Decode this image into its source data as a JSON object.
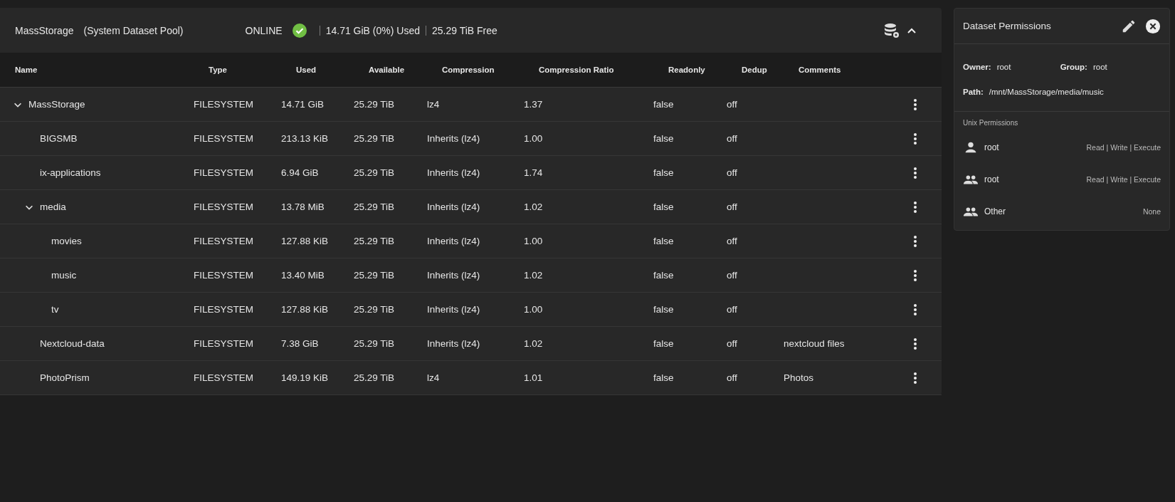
{
  "pool": {
    "name": "MassStorage",
    "subtitle": "(System Dataset Pool)",
    "status": "ONLINE",
    "healthy": true,
    "used": "14.71 GiB (0%) Used",
    "free": "25.29 TiB Free",
    "expanded": true
  },
  "table": {
    "columns": [
      "Name",
      "Type",
      "Used",
      "Available",
      "Compression",
      "Compression Ratio",
      "Readonly",
      "Dedup",
      "Comments"
    ],
    "rows": [
      {
        "name": "MassStorage",
        "type": "FILESYSTEM",
        "used": "14.71 GiB",
        "available": "25.29 TiB",
        "compression": "lz4",
        "ratio": "1.37",
        "readonly": "false",
        "dedup": "off",
        "expanded": true,
        "children": [
          {
            "name": "BIGSMB",
            "type": "FILESYSTEM",
            "used": "213.13 KiB",
            "available": "25.29 TiB",
            "compression": "Inherits (lz4)",
            "ratio": "1.00",
            "readonly": "false",
            "dedup": "off"
          },
          {
            "name": "ix-applications",
            "type": "FILESYSTEM",
            "used": "6.94 GiB",
            "available": "25.29 TiB",
            "compression": "Inherits (lz4)",
            "ratio": "1.74",
            "readonly": "false",
            "dedup": "off"
          },
          {
            "name": "media",
            "type": "FILESYSTEM",
            "used": "13.78 MiB",
            "available": "25.29 TiB",
            "compression": "Inherits (lz4)",
            "ratio": "1.02",
            "readonly": "false",
            "dedup": "off",
            "expanded": true,
            "children": [
              {
                "name": "movies",
                "type": "FILESYSTEM",
                "used": "127.88 KiB",
                "available": "25.29 TiB",
                "compression": "Inherits (lz4)",
                "ratio": "1.00",
                "readonly": "false",
                "dedup": "off"
              },
              {
                "name": "music",
                "type": "FILESYSTEM",
                "used": "13.40 MiB",
                "available": "25.29 TiB",
                "compression": "Inherits (lz4)",
                "ratio": "1.02",
                "readonly": "false",
                "dedup": "off"
              },
              {
                "name": "tv",
                "type": "FILESYSTEM",
                "used": "127.88 KiB",
                "available": "25.29 TiB",
                "compression": "Inherits (lz4)",
                "ratio": "1.00",
                "readonly": "false",
                "dedup": "off"
              }
            ]
          },
          {
            "name": "Nextcloud-data",
            "type": "FILESYSTEM",
            "used": "7.38 GiB",
            "available": "25.29 TiB",
            "compression": "Inherits (lz4)",
            "ratio": "1.02",
            "readonly": "false",
            "dedup": "off",
            "comments": "nextcloud files"
          },
          {
            "name": "PhotoPrism",
            "type": "FILESYSTEM",
            "used": "149.19 KiB",
            "available": "25.29 TiB",
            "compression": "lz4",
            "ratio": "1.01",
            "readonly": "false",
            "dedup": "off",
            "comments": "Photos"
          }
        ]
      }
    ]
  },
  "permissions": {
    "title": "Dataset Permissions",
    "owner_label": "Owner:",
    "owner": "root",
    "group_label": "Group:",
    "group": "root",
    "path_label": "Path:",
    "path": "/mnt/MassStorage/media/music",
    "section": "Unix Permissions",
    "entries": [
      {
        "kind": "user",
        "name": "root",
        "access": "Read | Write | Execute"
      },
      {
        "kind": "group",
        "name": "root",
        "access": "Read | Write | Execute"
      },
      {
        "kind": "other",
        "name": "Other",
        "access": "None"
      }
    ]
  }
}
